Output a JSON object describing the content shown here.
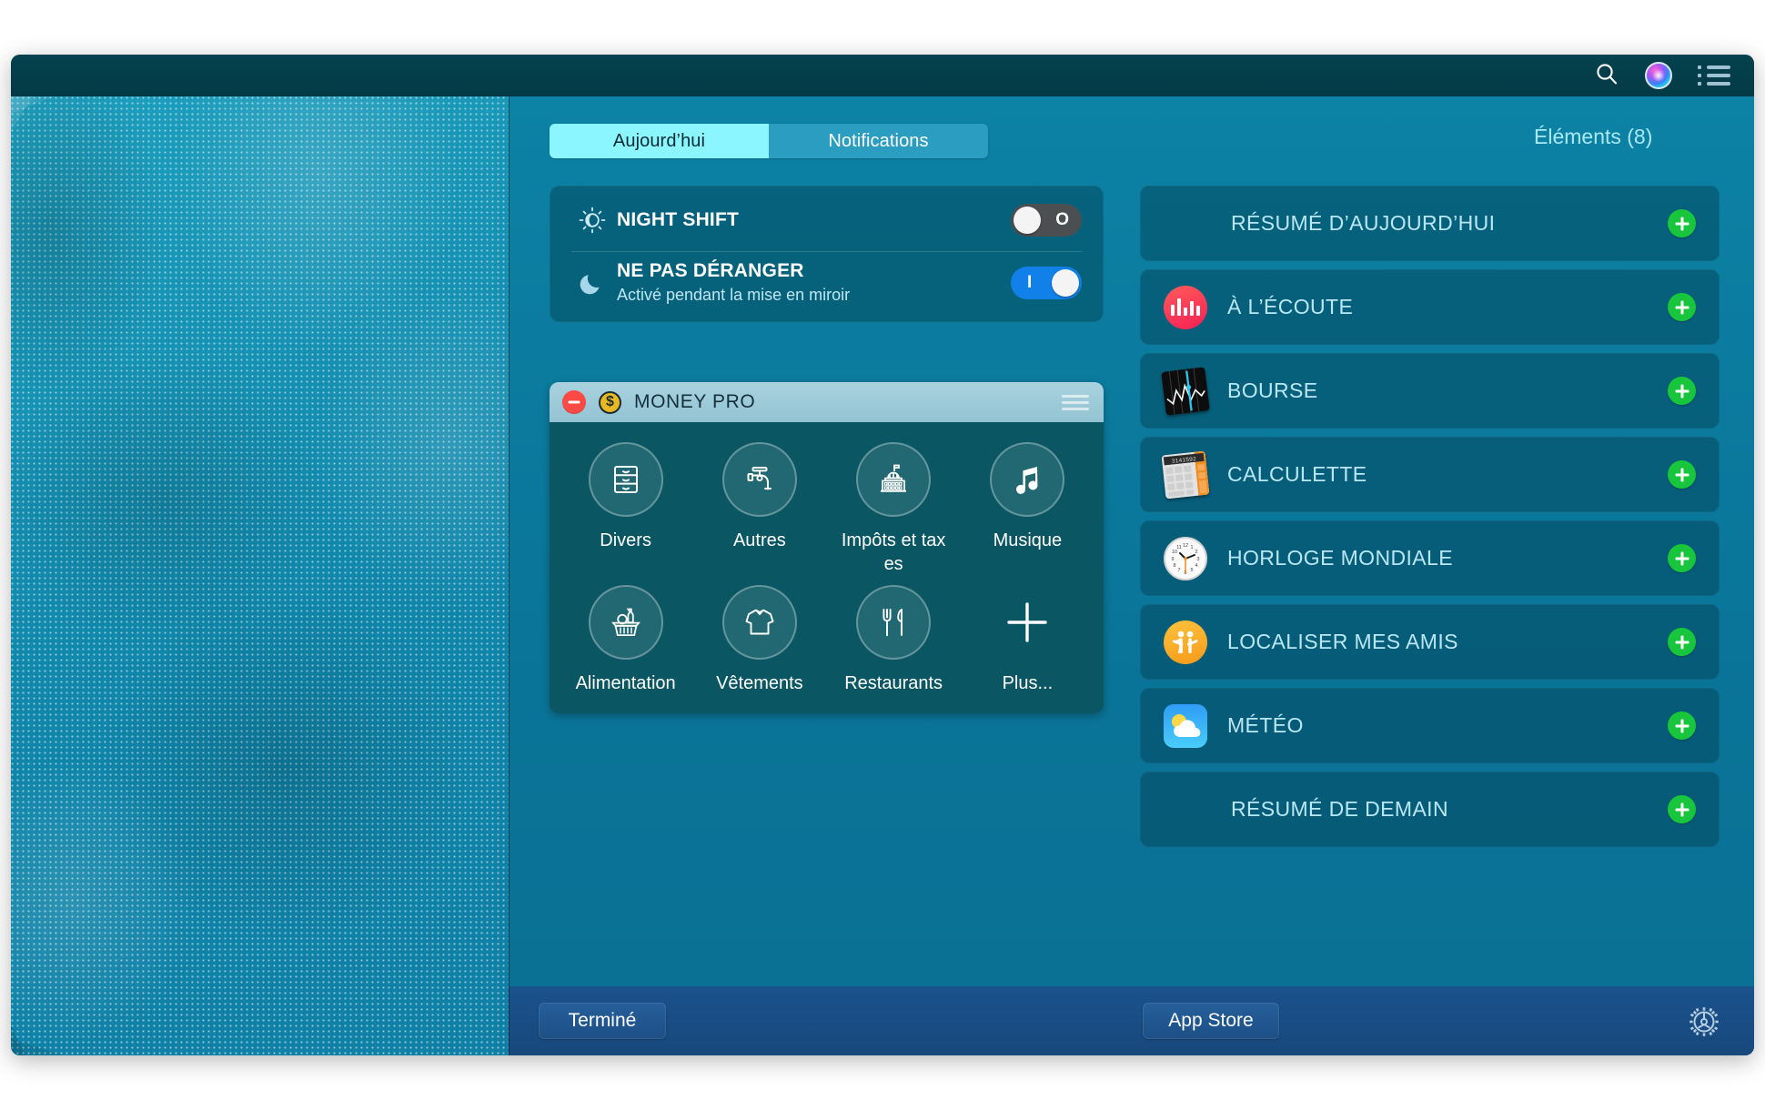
{
  "titlebar": {
    "icons": [
      {
        "name": "search-icon",
        "label": "Rechercher"
      },
      {
        "name": "siri-icon",
        "label": "Siri"
      },
      {
        "name": "list-icon",
        "label": "Liste"
      }
    ]
  },
  "notification_center": {
    "tabs": [
      {
        "id": "today",
        "label": "Aujourd’hui",
        "selected": true
      },
      {
        "id": "notifications",
        "label": "Notifications",
        "selected": false
      }
    ],
    "elements_header": "Éléments (8)",
    "switches": [
      {
        "title": "NIGHT SHIFT",
        "subtitle": "",
        "icon": "sun-icon",
        "state": "off",
        "mark": "O"
      },
      {
        "title": "NE PAS DÉRANGER",
        "subtitle": "Activé pendant la mise en miroir",
        "icon": "moon-icon",
        "state": "on",
        "mark": "I"
      }
    ],
    "widget": {
      "title": "MONEY PRO",
      "remove_label": "Supprimer",
      "app_icon": "dollar-coin-icon",
      "drag_handle": "drag-handle-icon",
      "tiles": [
        {
          "label": "Divers",
          "icon": "drawer-cabinet-icon"
        },
        {
          "label": "Autres",
          "icon": "faucet-icon"
        },
        {
          "label": "Impôts et taxes",
          "icon": "capitol-building-icon"
        },
        {
          "label": "Musique",
          "icon": "music-notes-icon"
        },
        {
          "label": "Alimentation",
          "icon": "shopping-basket-icon"
        },
        {
          "label": "Vêtements",
          "icon": "shirt-icon"
        },
        {
          "label": "Restaurants",
          "icon": "fork-knife-icon"
        },
        {
          "label": "Plus...",
          "icon": "plus-icon"
        }
      ]
    },
    "items": [
      {
        "label": "RÉSUMÉ D’AUJOURD’HUI",
        "icon": null,
        "add_label": "+"
      },
      {
        "label": "À L’ÉCOUTE",
        "icon": "shazam-icon",
        "add_label": "+"
      },
      {
        "label": "BOURSE",
        "icon": "stocks-icon",
        "add_label": "+"
      },
      {
        "label": "CALCULETTE",
        "icon": "calculator-icon",
        "add_label": "+"
      },
      {
        "label": "HORLOGE MONDIALE",
        "icon": "clock-icon",
        "add_label": "+"
      },
      {
        "label": "LOCALISER MES AMIS",
        "icon": "find-friends-icon",
        "add_label": "+"
      },
      {
        "label": "MÉTÉO",
        "icon": "weather-icon",
        "add_label": "+"
      },
      {
        "label": "RÉSUMÉ DE DEMAIN",
        "icon": null,
        "add_label": "+"
      }
    ],
    "footer": {
      "done_label": "Terminé",
      "appstore_label": "App Store",
      "settings_icon": "gear-icon"
    }
  },
  "colors": {
    "panel_bg": "#0a7599",
    "titlebar_bg": "#043c49",
    "tab_active_bg": "#8bf6ff",
    "tab_inactive_bg": "#2b9dc0",
    "widget_body_bg": "#0a5763",
    "widget_header_bg": "#9ccbd9",
    "toggle_on": "#1180e8",
    "toggle_off": "#4c4f52",
    "add_button_green": "#18c63d",
    "remove_button_red": "#fb4a46",
    "footer_bg": "#18487c",
    "item_text": "#b9e7f4"
  }
}
